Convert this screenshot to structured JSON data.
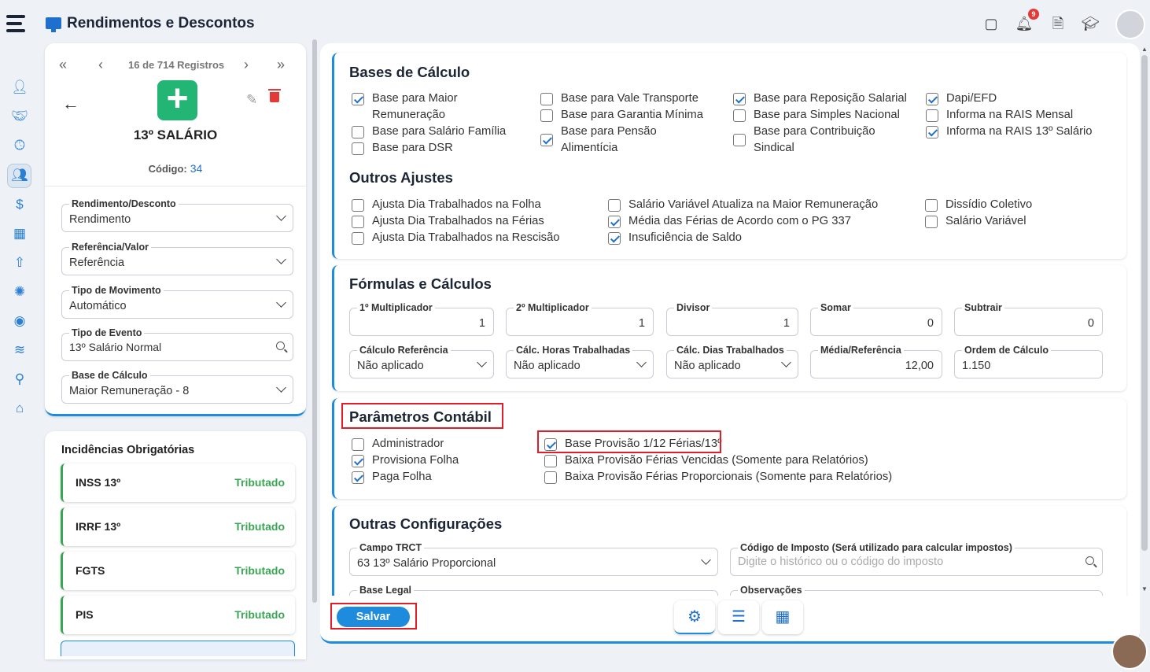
{
  "header": {
    "title": "Rendimentos e Descontos",
    "notif_count": "9"
  },
  "record_nav": {
    "first": "«",
    "prev": "‹",
    "status": "16 de 714 Registros",
    "next": "›",
    "last": "»"
  },
  "event": {
    "name": "13º SALÁRIO",
    "code_label": "Código:",
    "code_value": "34"
  },
  "left_fields": [
    {
      "label": "Rendimento/Desconto",
      "value": "Rendimento"
    },
    {
      "label": "Referência/Valor",
      "value": "Referência"
    },
    {
      "label": "Tipo de Movimento",
      "value": "Automático"
    },
    {
      "label": "Tipo de Evento",
      "value": "13º Salário Normal"
    },
    {
      "label": "Base de Cálculo",
      "value": "Maior Remuneração - 8"
    }
  ],
  "incidences": {
    "title": "Incidências Obrigatórias",
    "items": [
      {
        "name": "INSS 13º",
        "status": "Tributado"
      },
      {
        "name": "IRRF 13º",
        "status": "Tributado"
      },
      {
        "name": "FGTS",
        "status": "Tributado"
      },
      {
        "name": "PIS",
        "status": "Tributado"
      }
    ]
  },
  "bases": {
    "title": "Bases de Cálculo",
    "items": [
      {
        "label": "Base para Maior Remuneração",
        "checked": true
      },
      {
        "label": "Base para Salário Família",
        "checked": false
      },
      {
        "label": "Base para DSR",
        "checked": false
      },
      {
        "label": "Base para Vale Transporte",
        "checked": false
      },
      {
        "label": "Base para Garantia Mínima",
        "checked": false
      },
      {
        "label": "Base para Pensão Alimentícia",
        "checked": true
      },
      {
        "label": "Base para Reposição Salarial",
        "checked": true
      },
      {
        "label": "Base para Simples Nacional",
        "checked": false
      },
      {
        "label": "Base para Contribuição Sindical",
        "checked": false
      },
      {
        "label": "Dapi/EFD",
        "checked": true
      },
      {
        "label": "Informa na RAIS Mensal",
        "checked": false
      },
      {
        "label": "Informa na RAIS 13º Salário",
        "checked": true
      }
    ]
  },
  "ajustes": {
    "title": "Outros Ajustes",
    "items": [
      {
        "label": "Ajusta Dia Trabalhados na Folha",
        "checked": false
      },
      {
        "label": "Ajusta Dia Trabalhados na Férias",
        "checked": false
      },
      {
        "label": "Ajusta Dia Trabalhados na Rescisão",
        "checked": false
      },
      {
        "label": "Salário Variável Atualiza na Maior Remuneração",
        "checked": false
      },
      {
        "label": "Média das Férias de Acordo com o PG 337",
        "checked": true
      },
      {
        "label": "Insuficiência de Saldo",
        "checked": true
      },
      {
        "label": "Dissídio Coletivo",
        "checked": false
      },
      {
        "label": "Salário Variável",
        "checked": false
      }
    ]
  },
  "formulas": {
    "title": "Fórmulas e Cálculos",
    "fields": [
      {
        "label": "1º Multiplicador",
        "value": "1"
      },
      {
        "label": "2º Multiplicador",
        "value": "1"
      },
      {
        "label": "Divisor",
        "value": "1"
      },
      {
        "label": "Somar",
        "value": "0"
      },
      {
        "label": "Subtrair",
        "value": "0"
      },
      {
        "label": "Cálculo Referência",
        "value": "Não aplicado"
      },
      {
        "label": "Cálc. Horas Trabalhadas",
        "value": "Não aplicado"
      },
      {
        "label": "Cálc. Dias Trabalhados",
        "value": "Não aplicado"
      },
      {
        "label": "Média/Referência",
        "value": "12,00"
      },
      {
        "label": "Ordem de Cálculo",
        "value": "1.150"
      }
    ]
  },
  "contabil": {
    "title": "Parâmetros Contábil",
    "items": [
      {
        "label": "Administrador",
        "checked": false
      },
      {
        "label": "Provisiona Folha",
        "checked": true
      },
      {
        "label": "Paga Folha",
        "checked": true
      },
      {
        "label": "Base Provisão 1/12 Férias/13º",
        "checked": true
      },
      {
        "label": "Baixa Provisão Férias Vencidas (Somente para Relatórios)",
        "checked": false
      },
      {
        "label": "Baixa Provisão Férias Proporcionais (Somente para Relatórios)",
        "checked": false
      }
    ]
  },
  "outras": {
    "title": "Outras Configurações",
    "campo_trct_label": "Campo TRCT",
    "campo_trct_value": "63 13º Salário Proporcional",
    "imposto_label": "Código de Imposto (Será utilizado para calcular impostos)",
    "imposto_placeholder": "Digite o histórico ou o código do imposto",
    "base_legal_label": "Base Legal",
    "obs_label": "Observações"
  },
  "footer": {
    "save_label": "Salvar"
  },
  "colors": {
    "accent": "#1f8bdc",
    "success": "#22b573",
    "danger": "#e11d2a"
  }
}
